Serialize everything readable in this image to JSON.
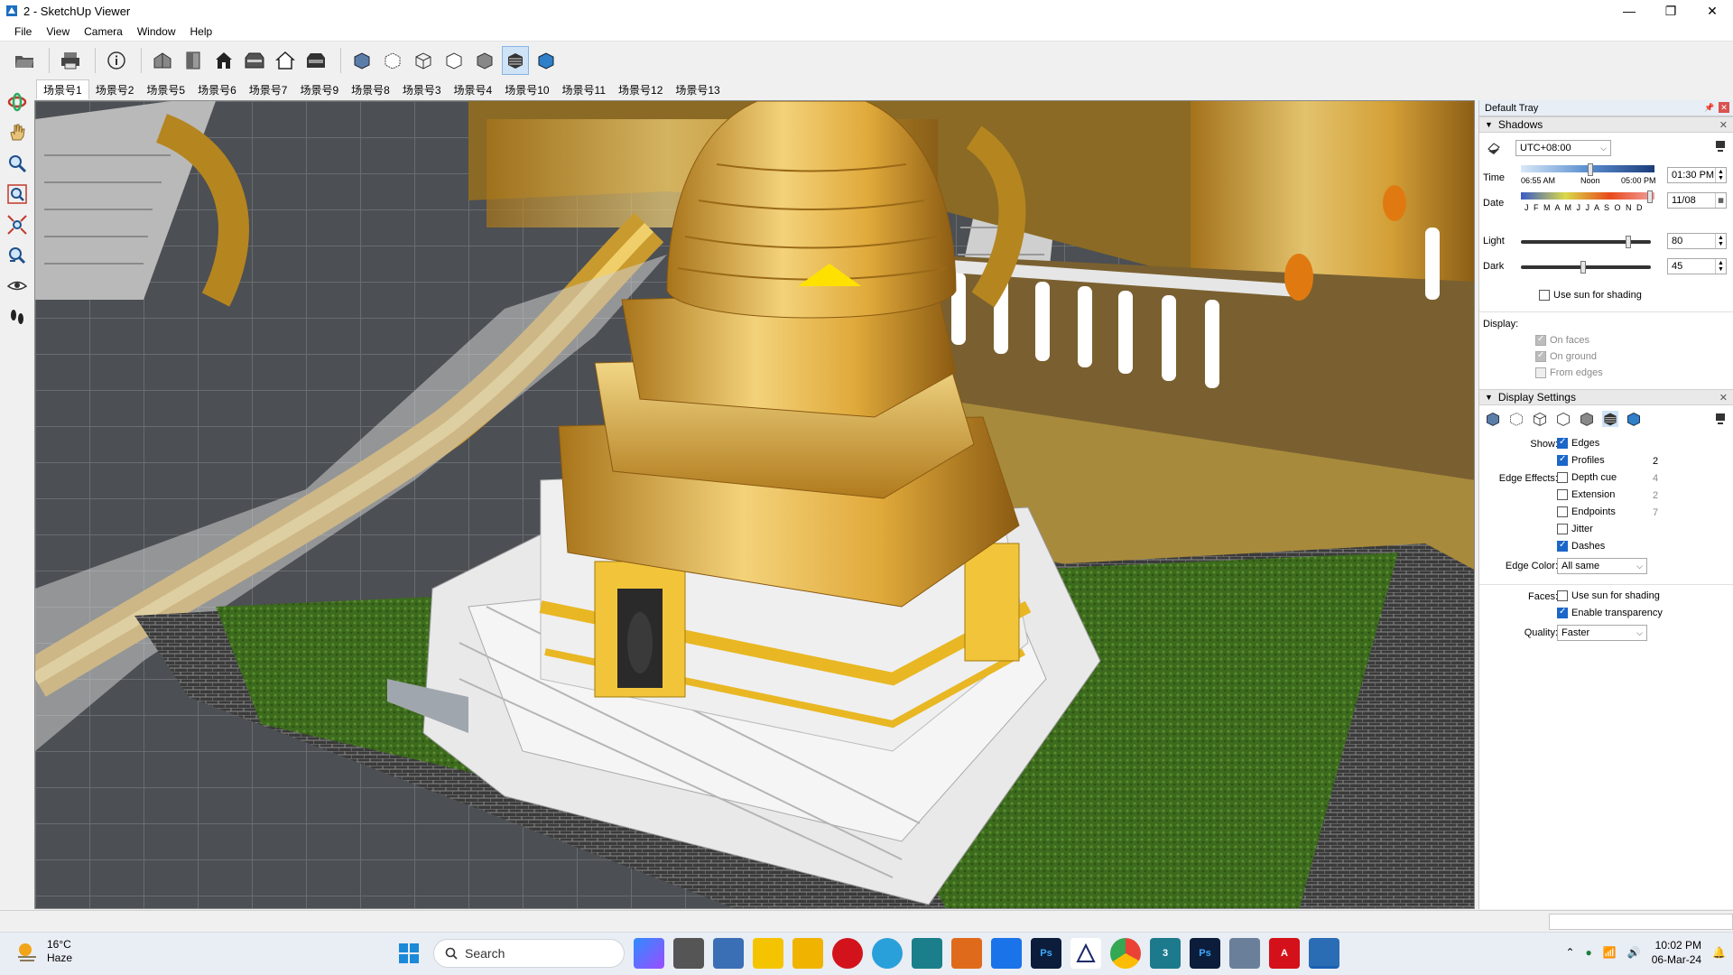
{
  "window": {
    "title": "2 - SketchUp Viewer",
    "controls": [
      "—",
      "❐",
      "✕"
    ]
  },
  "menu": [
    "File",
    "View",
    "Camera",
    "Window",
    "Help"
  ],
  "scenes": [
    "场景号1",
    "场景号2",
    "场景号5",
    "场景号6",
    "场景号7",
    "场景号9",
    "场景号8",
    "场景号3",
    "场景号4",
    "场景号10",
    "场景号11",
    "场景号12",
    "场景号13"
  ],
  "tray": {
    "title": "Default Tray",
    "shadows": {
      "title": "Shadows",
      "timezone": "UTC+08:00",
      "time_label": "Time",
      "time_start": "06:55 AM",
      "time_noon": "Noon",
      "time_end": "05:00 PM",
      "time_value": "01:30 PM",
      "date_label": "Date",
      "months": "J F M A M J J A S O N D",
      "date_value": "11/08",
      "light_label": "Light",
      "light_value": "80",
      "dark_label": "Dark",
      "dark_value": "45",
      "use_sun": "Use sun for shading",
      "display_label": "Display:",
      "on_faces": "On faces",
      "on_ground": "On ground",
      "from_edges": "From edges"
    },
    "display": {
      "title": "Display Settings",
      "show_label": "Show:",
      "edges": "Edges",
      "profiles": "Profiles",
      "profiles_n": "2",
      "edge_effects_label": "Edge Effects:",
      "depth_cue": "Depth cue",
      "depth_cue_n": "4",
      "extension": "Extension",
      "extension_n": "2",
      "endpoints": "Endpoints",
      "endpoints_n": "7",
      "jitter": "Jitter",
      "dashes": "Dashes",
      "edge_color_label": "Edge Color:",
      "edge_color": "All same",
      "faces_label": "Faces:",
      "faces_use_sun": "Use sun for shading",
      "enable_transparency": "Enable transparency",
      "quality_label": "Quality:",
      "quality": "Faster"
    }
  },
  "taskbar": {
    "temp": "16°C",
    "weather": "Haze",
    "search": "Search",
    "time": "10:02 PM",
    "date": "06-Mar-24"
  }
}
